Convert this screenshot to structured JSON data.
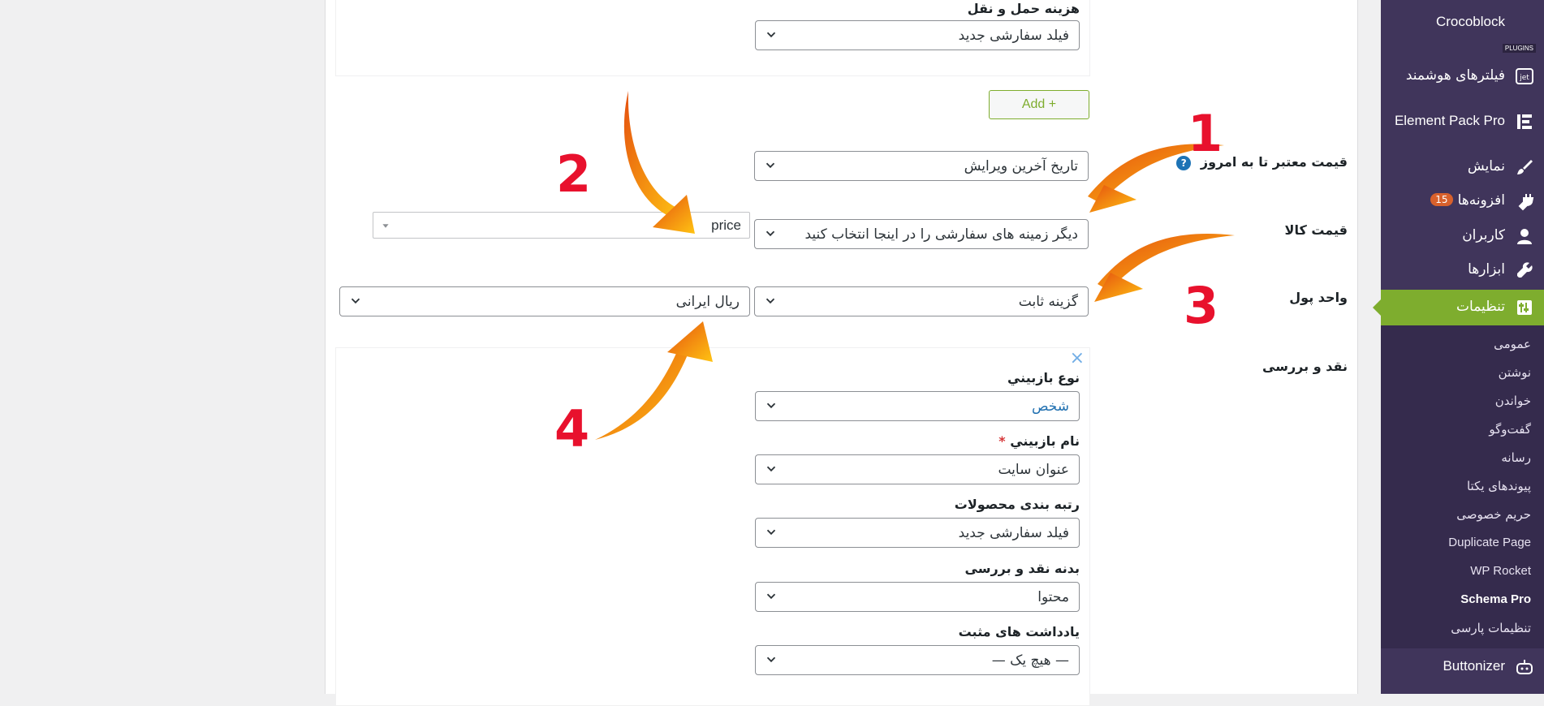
{
  "main": {
    "box1": {
      "label": "هزینه حمل و نقل",
      "select": "فیلد سفارشی جدید"
    },
    "add_button": "Add +",
    "rows": [
      {
        "label": "قیمت معتبر تا به امروز",
        "select": "تاریخ آخرین ویرایش"
      },
      {
        "label": "قیمت کالا",
        "select": "دیگر زمینه های سفارشی را در اینجا انتخاب کنید",
        "extra": "price"
      },
      {
        "label": "واحد پول",
        "select": "گزینه ثابت",
        "extra": "ریال ایرانی"
      },
      {
        "label": "نقد و بررسی"
      }
    ],
    "review_close": "×",
    "review_fields": [
      {
        "label": "نوع بازبيني",
        "value": "شخص",
        "required": false
      },
      {
        "label": "نام بازبيني",
        "value": "عنوان سایت",
        "required": true
      },
      {
        "label": "رتبه بندی محصولات",
        "value": "فیلد سفارشی جدید",
        "required": false
      },
      {
        "label": "بدنه نقد و بررسی",
        "value": "محتوا",
        "required": false
      },
      {
        "label": "يادداشت های مثبت",
        "value": "— هیچ یک —",
        "required": false
      }
    ],
    "required_star": "*",
    "callouts": [
      "1",
      "2",
      "3",
      "4"
    ],
    "accent_color": "#f39c12",
    "callout_color": "#e8112d"
  },
  "sidebar": {
    "items": [
      {
        "label": "Crocoblock",
        "icon": "crocoblock-icon"
      },
      {
        "label": "فیلترهای هوشمند",
        "icon": "jet-icon"
      },
      {
        "label": "Element Pack Pro",
        "icon": "element-pack-icon"
      },
      {
        "label": "نمایش",
        "icon": "brush-icon"
      },
      {
        "label": "افزونه‌ها",
        "icon": "plugin-icon",
        "badge": "15"
      },
      {
        "label": "کاربران",
        "icon": "user-icon"
      },
      {
        "label": "ابزارها",
        "icon": "wrench-icon"
      },
      {
        "label": "تنظیمات",
        "icon": "settings-icon",
        "active": true
      }
    ],
    "plugins_tag": "PLUGINS",
    "submenu": [
      "عمومی",
      "نوشتن",
      "خواندن",
      "گفت‌وگو",
      "رسانه",
      "پیوندهای یکتا",
      "حریم خصوصی",
      "Duplicate Page",
      "WP Rocket",
      "Schema Pro",
      "تنظیمات پارسی"
    ],
    "current_submenu": "Schema Pro",
    "buttonizer": "Buttonizer",
    "bg_color": "#40355b",
    "active_color": "#7ead2e"
  }
}
